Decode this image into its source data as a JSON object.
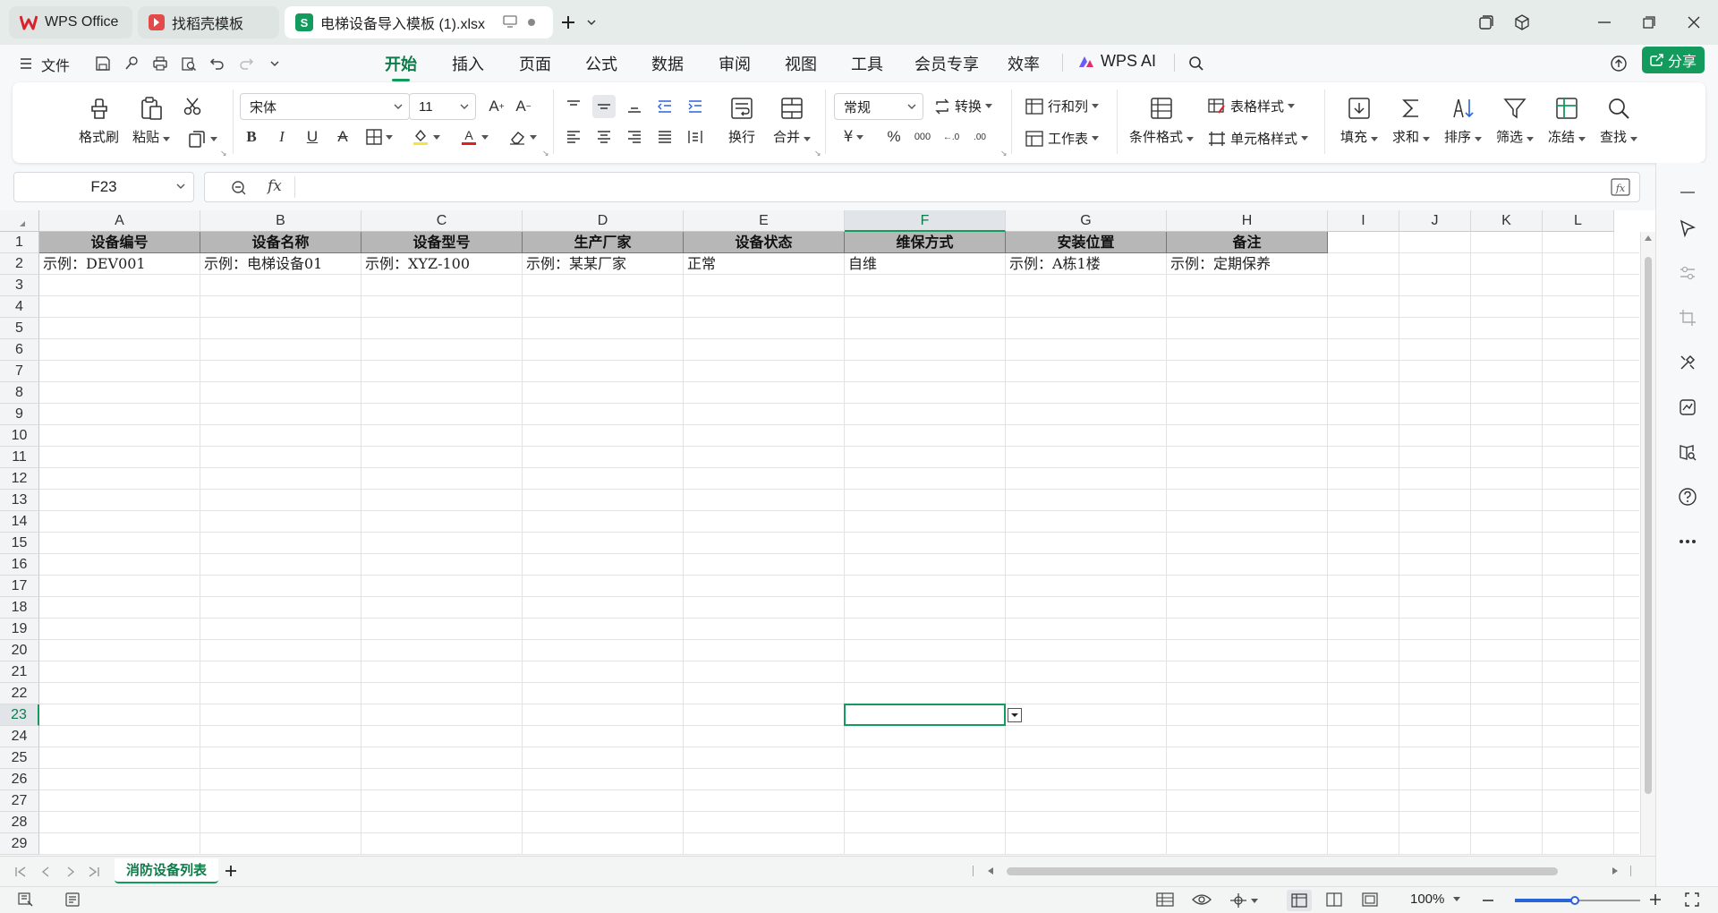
{
  "tabs": [
    {
      "label": "WPS Office"
    },
    {
      "label": "找稻壳模板"
    },
    {
      "label": "电梯设备导入模板 (1).xlsx"
    }
  ],
  "menu": {
    "file": "文件",
    "items": [
      "开始",
      "插入",
      "页面",
      "公式",
      "数据",
      "审阅",
      "视图",
      "工具",
      "会员专享",
      "效率"
    ],
    "ai": "WPS AI",
    "share": "分享"
  },
  "ribbon": {
    "format_painter": "格式刷",
    "paste": "粘贴",
    "font": "宋体",
    "font_size": "11",
    "wrap": "换行",
    "merge": "合并",
    "number_format": "常规",
    "convert": "转换",
    "row_col": "行和列",
    "table_style": "表格样式",
    "worksheet": "工作表",
    "cond_format": "条件格式",
    "cell_style": "单元格样式",
    "fill": "填充",
    "sum": "求和",
    "sort": "排序",
    "filter": "筛选",
    "freeze": "冻结",
    "find": "查找"
  },
  "formula": {
    "cell_ref": "F23",
    "fx": "fx",
    "value": ""
  },
  "columns": [
    "A",
    "B",
    "C",
    "D",
    "E",
    "F",
    "G",
    "H",
    "I",
    "J",
    "K",
    "L"
  ],
  "rows": [
    "1",
    "2",
    "3",
    "4",
    "5",
    "6",
    "7",
    "8",
    "9",
    "10",
    "11",
    "12",
    "13",
    "14",
    "15",
    "16",
    "17",
    "18",
    "19",
    "20",
    "21",
    "22",
    "23",
    "24",
    "25",
    "26",
    "27",
    "28",
    "29"
  ],
  "selected": {
    "column": "F",
    "row": "23"
  },
  "sheet": {
    "headers": [
      "设备编号",
      "设备名称",
      "设备型号",
      "生产厂家",
      "设备状态",
      "维保方式",
      "安装位置",
      "备注"
    ],
    "example": [
      "示例：DEV001",
      "示例：电梯设备01",
      "示例：XYZ-100",
      "示例：某某厂家",
      "正常",
      "自维",
      "示例：A栋1楼",
      "示例：定期保养"
    ]
  },
  "sheet_tabs": [
    {
      "label": "消防设备列表"
    }
  ],
  "status": {
    "zoom": "100%"
  },
  "colors": {
    "accent": "#129b5c",
    "header_fill": "#b7b7b7",
    "wps_red": "#d9232d"
  }
}
